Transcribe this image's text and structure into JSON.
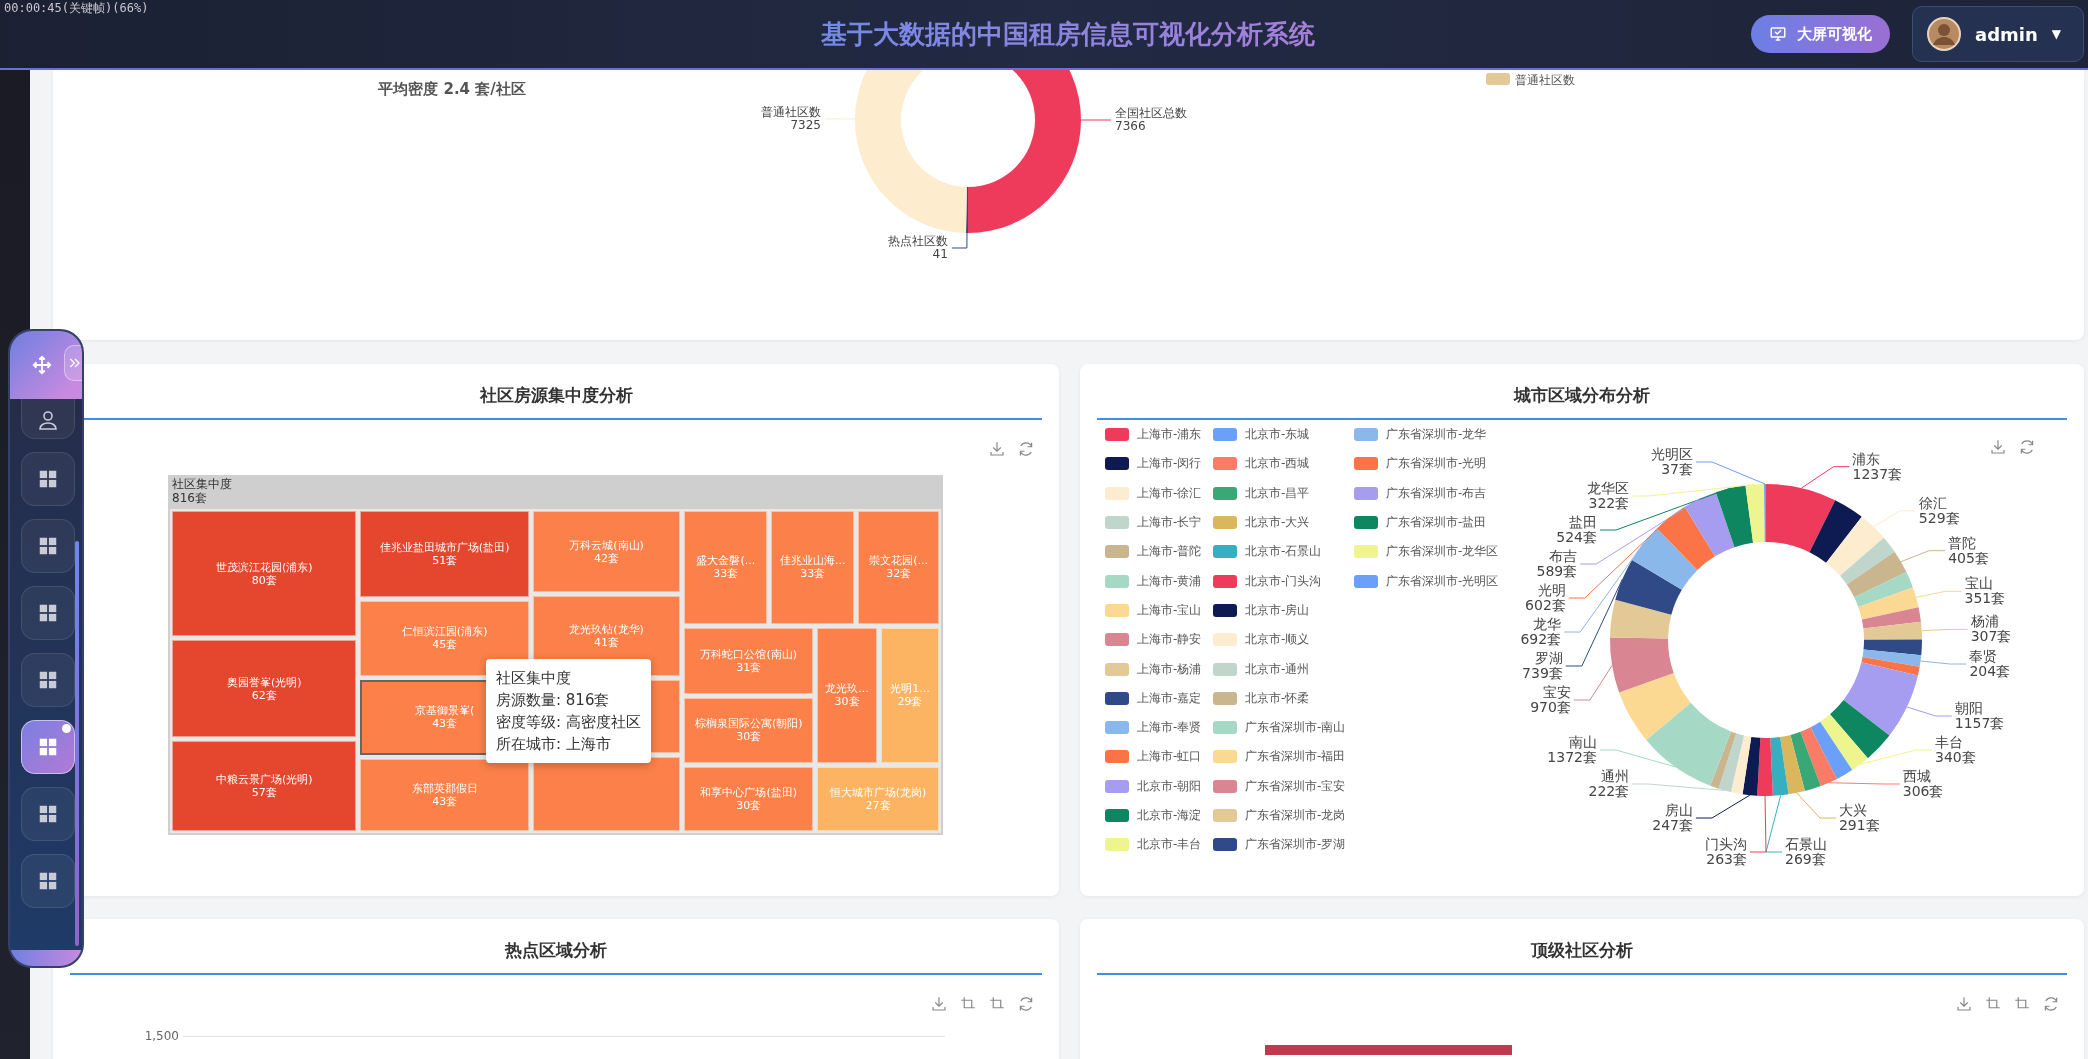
{
  "recorder_overlay": "00:00:45(关键帧)(66%)",
  "header": {
    "title": "基于大数据的中国租房信息可视化分析系统",
    "screen_button": "大屏可视化",
    "user": {
      "name": "admin",
      "caret": "▼"
    }
  },
  "sidebar": {
    "items": [
      {
        "kind": "user",
        "selected": false
      },
      {
        "kind": "grid",
        "selected": false
      },
      {
        "kind": "grid",
        "selected": false
      },
      {
        "kind": "grid",
        "selected": false
      },
      {
        "kind": "grid",
        "selected": false
      },
      {
        "kind": "grid",
        "selected": true
      },
      {
        "kind": "grid",
        "selected": false
      },
      {
        "kind": "grid",
        "selected": false
      }
    ]
  },
  "overview": {
    "density": "平均密度 2.4 套/社区",
    "legend": [
      {
        "label": "普通社区数",
        "color": "#e3c996"
      }
    ],
    "slices": [
      {
        "color": "#ee3a5b"
      },
      {
        "color": "#2f4a86"
      },
      {
        "color": "#fdeccd"
      }
    ],
    "chart_data": {
      "type": "donut",
      "categories": [
        "全国社区总数",
        "热点社区数",
        "普通社区数"
      ],
      "values": [
        7366,
        41,
        7325
      ],
      "data_labels": true
    }
  },
  "concentration": {
    "title": "社区房源集中度分析",
    "tools": [
      {
        "kind": "download"
      },
      {
        "kind": "refresh"
      }
    ],
    "treemap": {
      "root_name": "社区集中度",
      "root_count": "816套",
      "tiles": [
        {
          "name": "世茂滨江花园(浦东)",
          "count": "80套",
          "color": "#e4472d",
          "highlighted": false
        },
        {
          "name": "奥园誉峯(光明)",
          "count": "62套",
          "color": "#e4472d",
          "highlighted": false
        },
        {
          "name": "中粮云景广场(光明)",
          "count": "57套",
          "color": "#e4472d",
          "highlighted": false
        },
        {
          "name": "佳兆业盐田城市广场(盐田)",
          "count": "51套",
          "color": "#e4472d",
          "highlighted": false
        },
        {
          "name": "仁恒滨江园(浦东)",
          "count": "45套",
          "color": "#fb8049",
          "highlighted": false
        },
        {
          "name": "京基御景峯(",
          "count": "43套",
          "color": "#fb8049",
          "highlighted": true
        },
        {
          "name": "东部英郡假日",
          "count": "43套",
          "color": "#fb8049",
          "highlighted": false
        },
        {
          "name": "万科云城(南山)",
          "count": "42套",
          "color": "#fb8049",
          "highlighted": false
        },
        {
          "name": "龙光玖钻(龙华)",
          "count": "41套",
          "color": "#fb8049",
          "highlighted": false
        },
        {
          "color": "#fb8049",
          "highlighted": false
        },
        {
          "color": "#fb8049",
          "highlighted": false
        },
        {
          "name": "盛大金磐(...",
          "count": "33套",
          "color": "#fb8049",
          "highlighted": false
        },
        {
          "name": "佳兆业山海...",
          "count": "33套",
          "color": "#fb8049",
          "highlighted": false
        },
        {
          "name": "崇文花园(...",
          "count": "32套",
          "color": "#fb8049",
          "highlighted": false
        },
        {
          "name": "万科蛇口公馆(南山)",
          "count": "31套",
          "color": "#fb8049",
          "highlighted": false
        },
        {
          "name": "棕榈泉国际公寓(朝阳)",
          "count": "30套",
          "color": "#fb8049",
          "highlighted": false
        },
        {
          "name": "和享中心广场(盐田)",
          "count": "30套",
          "color": "#fb8049",
          "highlighted": false
        },
        {
          "name": "龙光玖...",
          "count": "30套",
          "color": "#fb8049",
          "highlighted": false
        },
        {
          "name": "光明1...",
          "count": "29套",
          "color": "#fdb462",
          "highlighted": false
        },
        {
          "name": "恒大城市广场(龙岗)",
          "count": "27套",
          "color": "#fdb462",
          "highlighted": false
        }
      ]
    },
    "tooltip": {
      "title": "社区集中度",
      "lines": [
        "房源数量: 816套",
        "密度等级: 高密度社区",
        "所在城市: 上海市"
      ]
    }
  },
  "regions": {
    "title": "城市区域分布分析",
    "tools": [
      {
        "kind": "download"
      },
      {
        "kind": "refresh"
      }
    ],
    "swatches": [
      {
        "color": "#ee3a5b"
      },
      {
        "color": "#0d1b52"
      },
      {
        "color": "#fdeccd"
      },
      {
        "color": "#c0d6cc"
      },
      {
        "color": "#c9b68f"
      },
      {
        "color": "#a6d8c6"
      },
      {
        "color": "#fbd992"
      },
      {
        "color": "#d98592"
      },
      {
        "color": "#e3c996"
      },
      {
        "color": "#2f4a86"
      },
      {
        "color": "#8ab8ea"
      },
      {
        "color": "#fb7448"
      },
      {
        "color": "#a79df0"
      },
      {
        "color": "#0e8760"
      },
      {
        "color": "#eef48e"
      },
      {
        "color": "#6aa0fa"
      },
      {
        "color": "#fa7c67"
      },
      {
        "color": "#3aa776"
      },
      {
        "color": "#dab65d"
      },
      {
        "color": "#36b0c0"
      },
      {
        "color": "#ee3a5b"
      },
      {
        "color": "#0d1b52"
      },
      {
        "color": "#fdeccd"
      },
      {
        "color": "#c0d6cc"
      },
      {
        "color": "#c9b68f"
      },
      {
        "color": "#a6d8c6"
      },
      {
        "color": "#fbd992"
      },
      {
        "color": "#d98592"
      },
      {
        "color": "#e3c996"
      },
      {
        "color": "#2f4a86"
      },
      {
        "color": "#8ab8ea"
      },
      {
        "color": "#fb7448"
      },
      {
        "color": "#a79df0"
      },
      {
        "color": "#0e8760"
      },
      {
        "color": "#eef48e"
      },
      {
        "color": "#6aa0fa"
      }
    ],
    "chart_data": {
      "type": "donut",
      "categories": [
        "上海市-浦东",
        "上海市-闵行",
        "上海市-徐汇",
        "上海市-长宁",
        "上海市-普陀",
        "上海市-黄浦",
        "上海市-宝山",
        "上海市-静安",
        "上海市-杨浦",
        "上海市-嘉定",
        "上海市-奉贤",
        "上海市-虹口",
        "北京市-朝阳",
        "北京市-海淀",
        "北京市-丰台",
        "北京市-东城",
        "北京市-西城",
        "北京市-昌平",
        "北京市-大兴",
        "北京市-石景山",
        "北京市-门头沟",
        "北京市-房山",
        "北京市-顺义",
        "北京市-通州",
        "北京市-怀柔",
        "广东省深圳市-南山",
        "广东省深圳市-福田",
        "广东省深圳市-宝安",
        "广东省深圳市-龙岗",
        "广东省深圳市-罗湖",
        "广东省深圳市-龙华",
        "广东省深圳市-光明",
        "广东省深圳市-布吉",
        "广东省深圳市-盐田",
        "广东省深圳市-龙华区",
        "广东省深圳市-光明区"
      ],
      "values": [
        7.3,
        3.2,
        3.1,
        1.8,
        2.4,
        1.7,
        2.1,
        1.5,
        1.8,
        1.6,
        1.2,
        0.9,
        6.8,
        3.2,
        2.0,
        1.8,
        1.8,
        1.7,
        1.7,
        1.6,
        1.6,
        1.5,
        1.2,
        1.3,
        0.9,
        8.1,
        5.6,
        5.7,
        3.9,
        4.4,
        4.1,
        3.6,
        3.5,
        3.1,
        1.9,
        0.2
      ],
      "value_labels": [
        {
          "name": "浦东",
          "value": "1237套"
        },
        null,
        {
          "name": "徐汇",
          "value": "529套"
        },
        null,
        {
          "name": "普陀",
          "value": "405套"
        },
        null,
        {
          "name": "宝山",
          "value": "351套"
        },
        null,
        {
          "name": "杨浦",
          "value": "307套"
        },
        null,
        {
          "name": "奉贤",
          "value": "204套"
        },
        null,
        {
          "name": "朝阳",
          "value": "1157套"
        },
        null,
        {
          "name": "丰台",
          "value": "340套"
        },
        null,
        {
          "name": "西城",
          "value": "306套"
        },
        null,
        {
          "name": "大兴",
          "value": "291套"
        },
        {
          "name": "石景山",
          "value": "269套"
        },
        {
          "name": "门头沟",
          "value": "263套"
        },
        {
          "name": "房山",
          "value": "247套"
        },
        null,
        {
          "name": "通州",
          "value": "222套"
        },
        null,
        {
          "name": "南山",
          "value": "1372套"
        },
        null,
        {
          "name": "宝安",
          "value": "970套"
        },
        null,
        {
          "name": "罗湖",
          "value": "739套"
        },
        {
          "name": "龙华",
          "value": "692套"
        },
        {
          "name": "光明",
          "value": "602套"
        },
        {
          "name": "布吉",
          "value": "589套"
        },
        {
          "name": "盐田",
          "value": "524套"
        },
        {
          "name": "龙华区",
          "value": "322套"
        },
        {
          "name": "光明区",
          "value": "37套"
        }
      ]
    }
  },
  "hotspots": {
    "title": "热点区域分析",
    "tools": [
      {
        "kind": "download"
      },
      {
        "kind": "crop"
      },
      {
        "kind": "crop"
      },
      {
        "kind": "refresh"
      }
    ],
    "y_tick": "1,500"
  },
  "top_communities": {
    "title": "顶级社区分析",
    "tools": [
      {
        "kind": "download"
      },
      {
        "kind": "crop"
      },
      {
        "kind": "crop"
      },
      {
        "kind": "refresh"
      }
    ]
  }
}
